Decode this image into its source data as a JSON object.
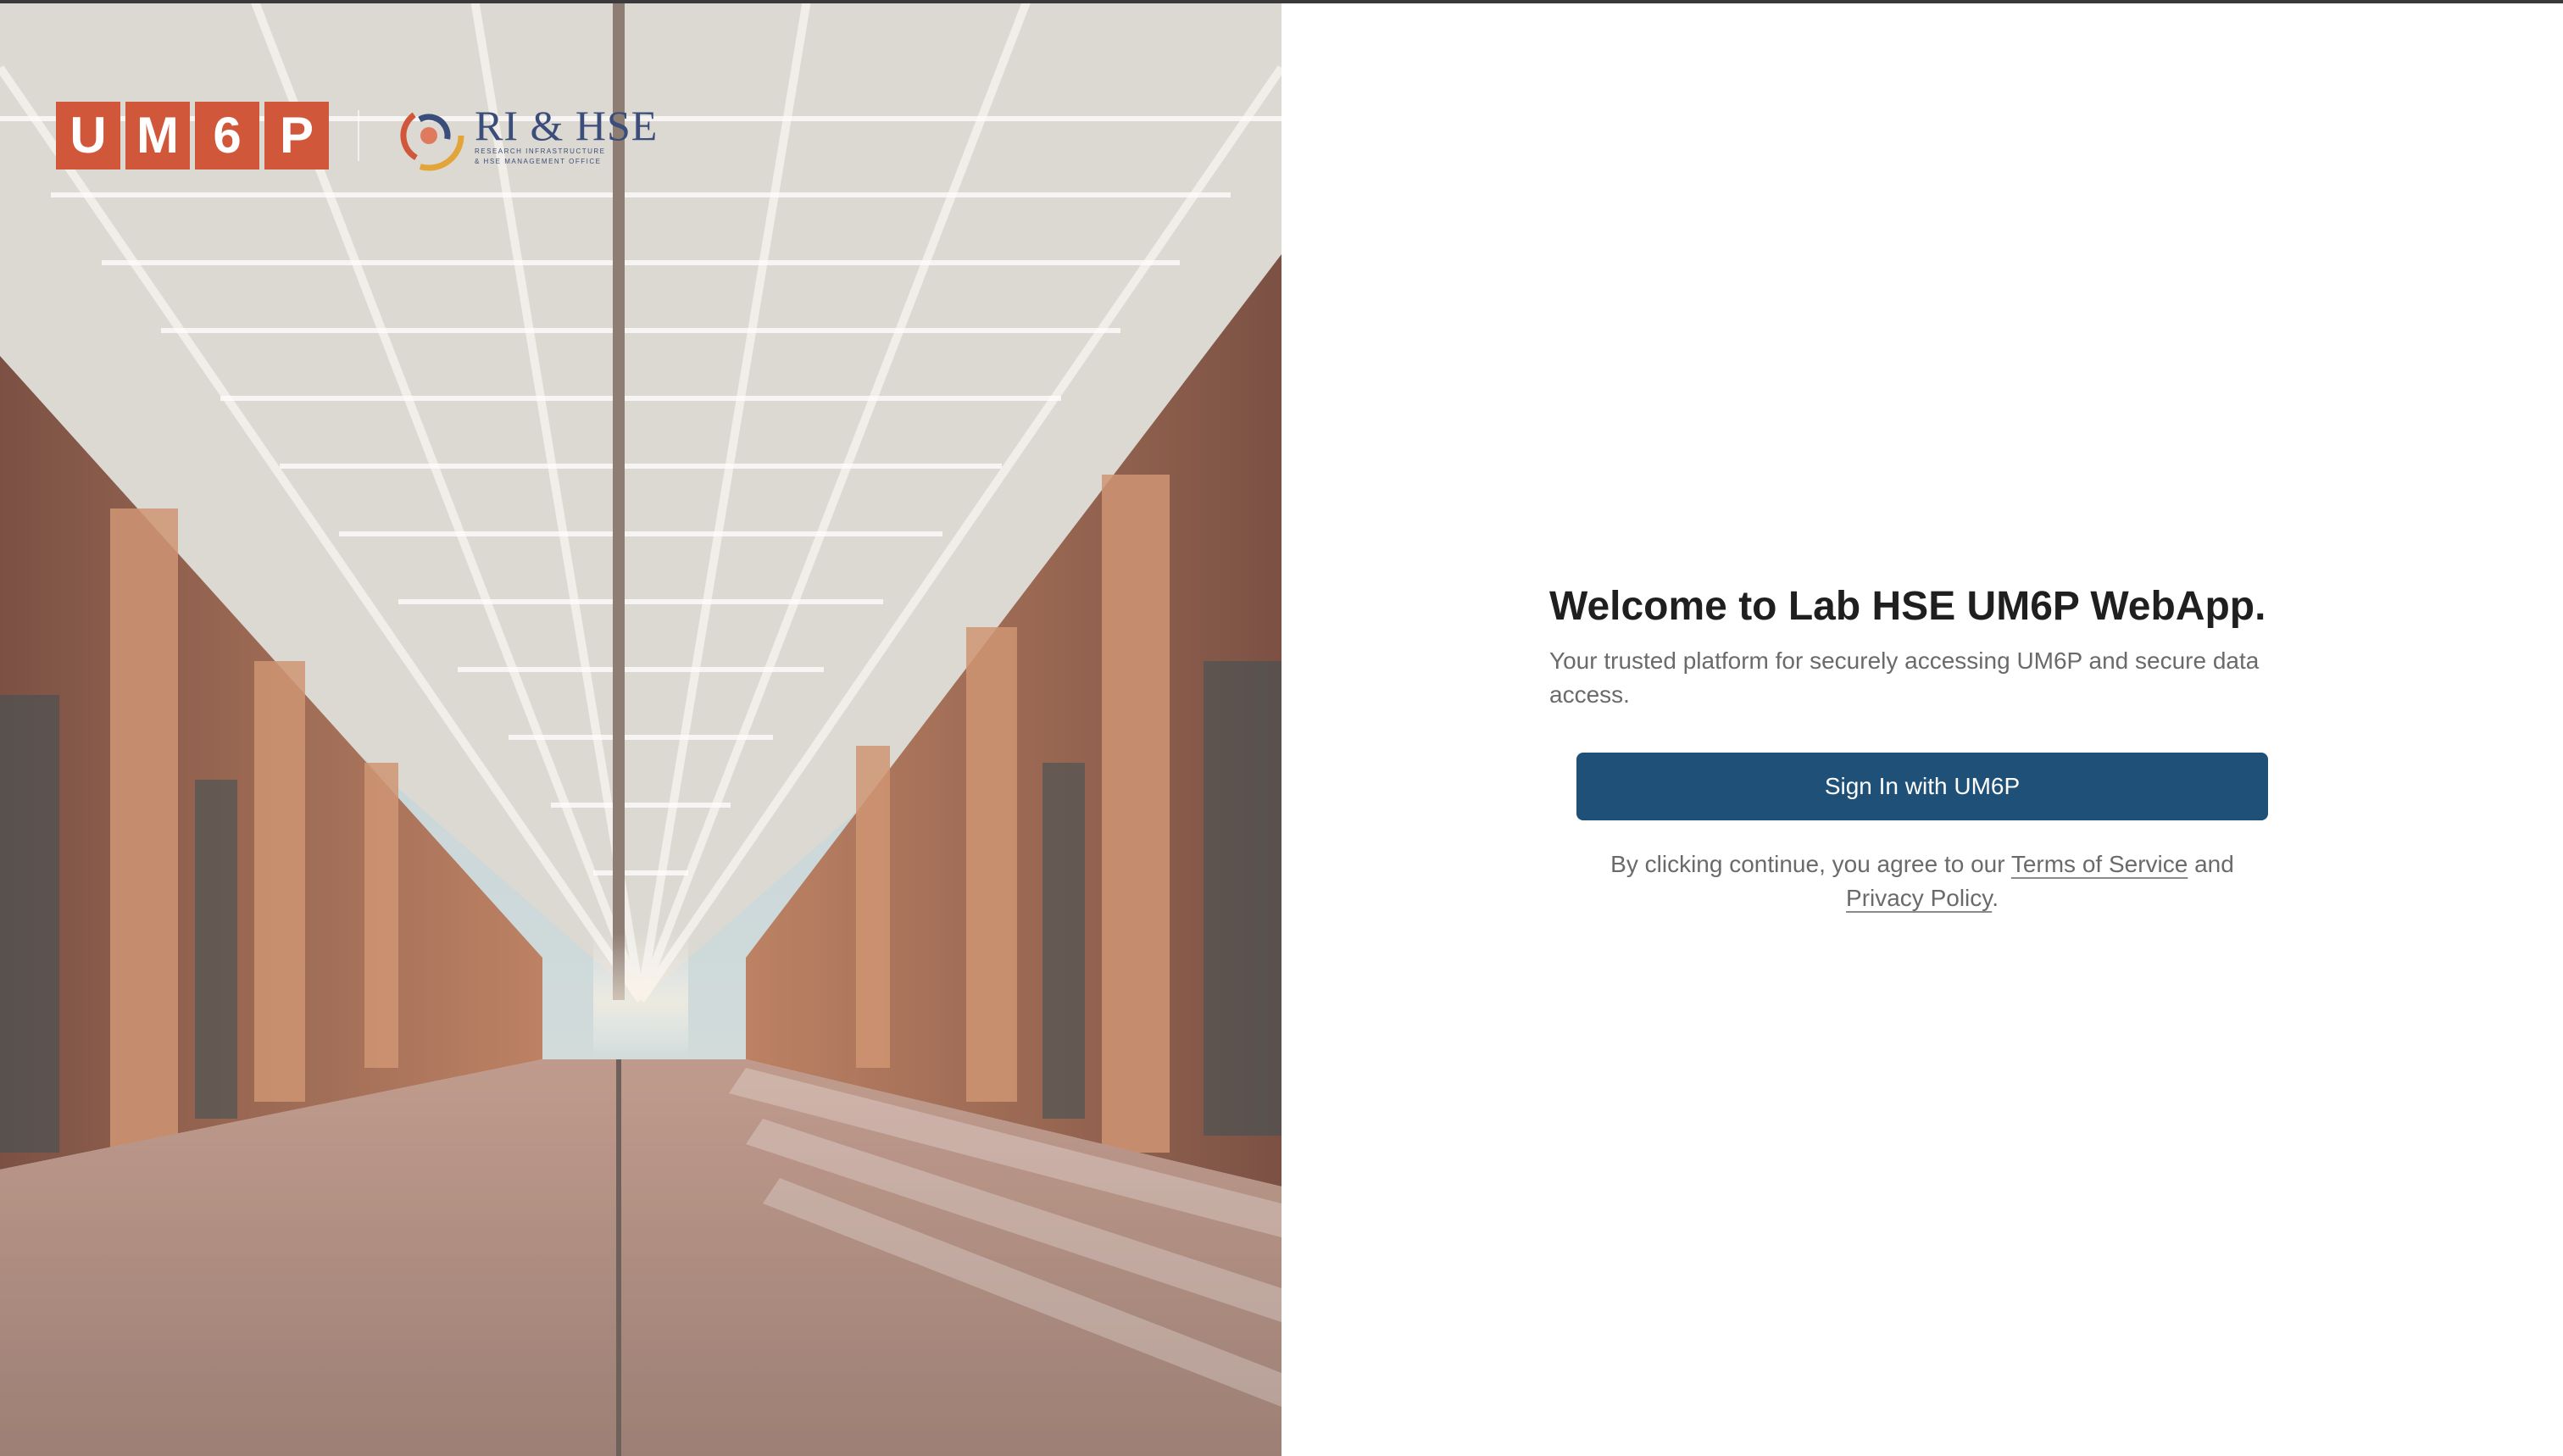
{
  "branding": {
    "um6p_letters": [
      "U",
      "M",
      "6",
      "P"
    ],
    "ri_hse_title": "RI & HSE",
    "ri_hse_subtitle_line1": "RESEARCH INFRASTRUCTURE",
    "ri_hse_subtitle_line2": "& HSE MANAGEMENT OFFICE"
  },
  "login": {
    "title": "Welcome to Lab HSE UM6P WebApp.",
    "subtitle": "Your trusted platform for securely accessing UM6P and secure data access.",
    "signin_button_label": "Sign In with UM6P",
    "legal_prefix": "By clicking continue, you agree to our ",
    "terms_link": "Terms of Service",
    "legal_middle": " and ",
    "privacy_link": "Privacy Policy",
    "legal_suffix": "."
  },
  "colors": {
    "primary_button": "#1f5077",
    "um6p_orange": "#d0573a",
    "title_text": "#1f1f1f",
    "muted_text": "#6a6a6a",
    "ri_hse_blue": "#3b4d7a"
  },
  "icons": {
    "ri_hse_emblem": "swirl-emblem-icon"
  }
}
